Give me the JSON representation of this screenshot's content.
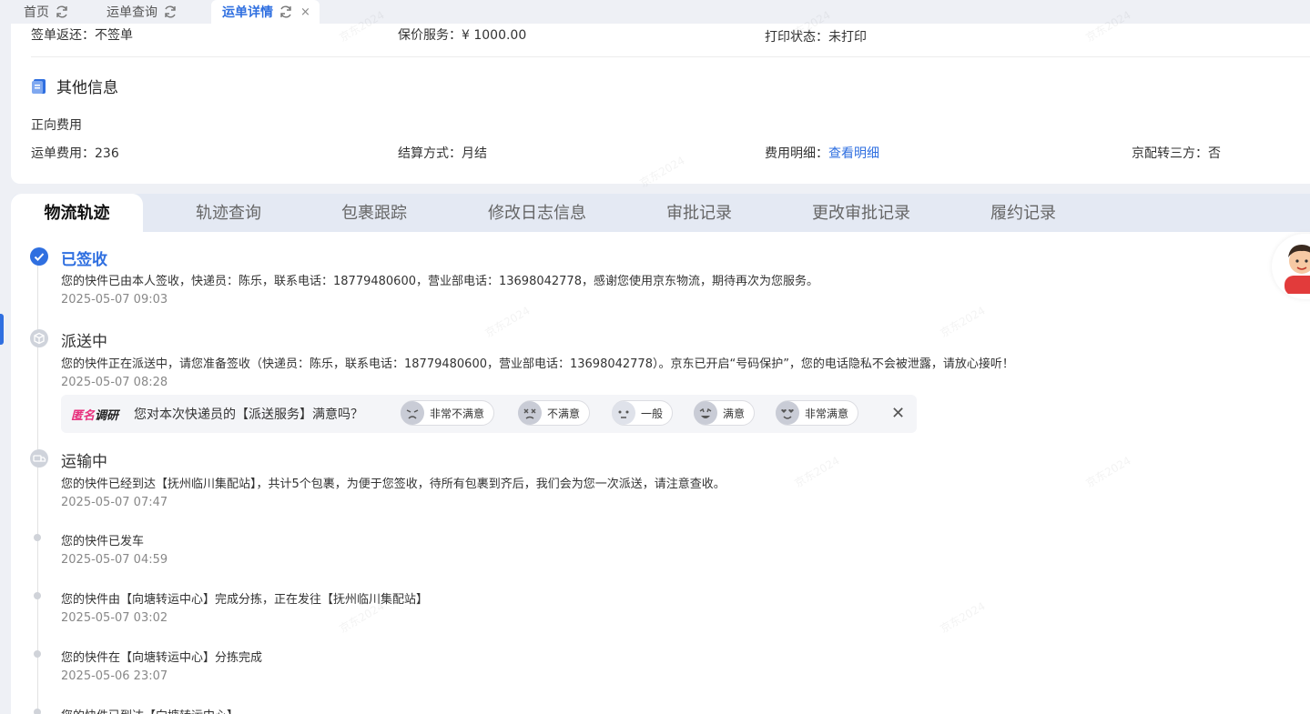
{
  "tabs": [
    {
      "label": "首页",
      "active": false
    },
    {
      "label": "运单查询",
      "active": false
    },
    {
      "label": "运单详情",
      "active": true,
      "close": "×"
    }
  ],
  "info": {
    "sign_return": "签单返还：不签单",
    "insured": "保价服务：¥ 1000.00",
    "print_status": "打印状态：未打印",
    "other_title": "其他信息",
    "forward_fee_title": "正向费用",
    "freight": "运单费用：236",
    "settlement": "结算方式：月结",
    "fee_detail_label": "费用明细：",
    "fee_detail_link": "查看明细",
    "third_party": "京配转三方：否"
  },
  "detail_tabs": [
    "物流轨迹",
    "轨迹查询",
    "包裹跟踪",
    "修改日志信息",
    "审批记录",
    "更改审批记录",
    "履约记录"
  ],
  "events": [
    {
      "title": "已签收",
      "desc": "您的快件已由本人签收，快递员：陈乐，联系电话：18779480600，营业部电话：13698042778，感谢您使用京东物流，期待再次为您服务。",
      "time": "2025-05-07 09:03"
    },
    {
      "title": "派送中",
      "desc": "您的快件正在派送中，请您准备签收（快递员：陈乐，联系电话：18779480600，营业部电话：13698042778）。京东已开启“号码保护”，您的电话隐私不会被泄露，请放心接听！",
      "time": "2025-05-07 08:28"
    },
    {
      "title": "运输中",
      "desc": "您的快件已经到达【抚州临川集配站】，共计5个包裹，为便于您签收，待所有包裹到齐后，我们会为您一次派送，请注意查收。",
      "time": "2025-05-07 07:47"
    },
    {
      "desc": "您的快件已发车",
      "time": "2025-05-07 04:59"
    },
    {
      "desc": "您的快件由【向塘转运中心】完成分拣，正在发往【抚州临川集配站】",
      "time": "2025-05-07 03:02"
    },
    {
      "desc": "您的快件在【向塘转运中心】分拣完成",
      "time": "2025-05-06 23:07"
    },
    {
      "desc": "您的快件已到达【向塘转运中心】"
    }
  ],
  "survey": {
    "brand_a": "匿名",
    "brand_b": "调研",
    "question": "您对本次快递员的【派送服务】满意吗？",
    "options": [
      "非常不满意",
      "不满意",
      "一般",
      "满意",
      "非常满意"
    ],
    "close": "✕"
  },
  "watermark": "京东2024",
  "colors": {
    "accent": "#2f6fe0",
    "brand_pink": "#e7317d"
  }
}
